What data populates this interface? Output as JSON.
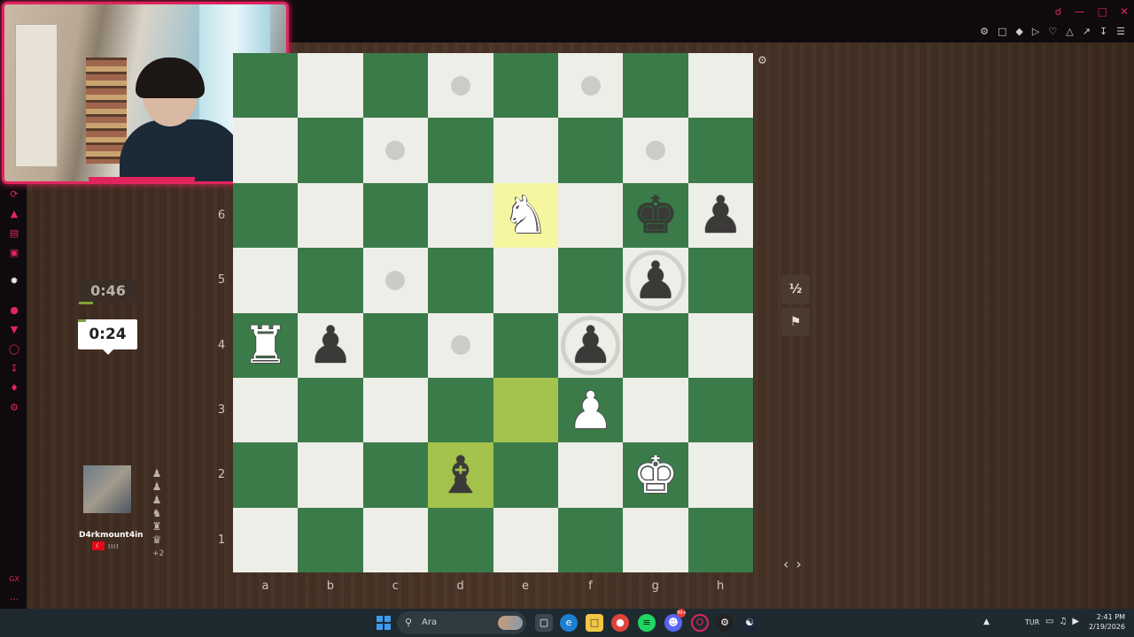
{
  "topbar": {
    "window_controls": [
      "search-icon",
      "minimize-icon",
      "maximize-icon",
      "close-icon"
    ],
    "toolbar_icons": [
      "pin-icon",
      "crop-icon",
      "shield-icon",
      "play-icon",
      "heart-icon",
      "puzzle-icon",
      "share-icon",
      "download-icon",
      "menu-icon"
    ]
  },
  "sidebar": {
    "icons": [
      "refresh-icon",
      "cart-icon",
      "gamepad-icon",
      "m-icon",
      "chatgpt-icon",
      "record-icon",
      "pin-icon",
      "clock-icon",
      "download-icon",
      "puzzle-icon",
      "settings-icon",
      "gx-icon",
      "more-icon"
    ],
    "bottom_label": "GX",
    "more_label": "..."
  },
  "game": {
    "opponent_time": "0:46",
    "my_time": "0:24",
    "player_name": "D4rkmount4in",
    "flag": "TR",
    "rating_marks": "IIII",
    "captured_pieces": [
      "♟",
      "♟",
      "♟",
      "♞",
      "♜",
      "♛"
    ],
    "captured_advantage": "+2",
    "ranks": [
      "6",
      "5",
      "4",
      "3",
      "2",
      "1"
    ],
    "files": [
      "a",
      "b",
      "c",
      "d",
      "e",
      "f",
      "g",
      "h"
    ],
    "draw_label": "½",
    "resign_label": "⚑",
    "nav_left": "‹",
    "nav_right": "›",
    "board": [
      [
        "",
        "",
        "",
        "",
        "",
        "",
        "",
        ""
      ],
      [
        "",
        "",
        "",
        "",
        "",
        "",
        "",
        ""
      ],
      [
        "",
        "",
        "",
        "",
        "N",
        "",
        "k",
        "p"
      ],
      [
        "",
        "",
        "",
        "",
        "",
        "",
        "p",
        ""
      ],
      [
        "R",
        "p",
        "",
        "",
        "",
        "p",
        "",
        ""
      ],
      [
        "",
        "",
        "",
        "",
        "",
        "P",
        "",
        ""
      ],
      [
        "",
        "",
        "",
        "b",
        "",
        "",
        "K",
        ""
      ],
      [
        "",
        "",
        "",
        "",
        "",
        "",
        "",
        ""
      ]
    ],
    "move_dots": [
      [
        0,
        3
      ],
      [
        0,
        5
      ],
      [
        1,
        2
      ],
      [
        1,
        6
      ],
      [
        3,
        2
      ],
      [
        4,
        3
      ]
    ],
    "capture_rings": [
      [
        3,
        6
      ],
      [
        4,
        5
      ]
    ],
    "highlights": [
      [
        2,
        4,
        "knight"
      ],
      [
        5,
        4,
        "last"
      ],
      [
        6,
        3,
        "last"
      ]
    ],
    "colors": {
      "light": "#eeeee8",
      "dark": "#3b7b4a",
      "highlight": "#a3c34c",
      "knight_highlight": "#f6f6a0",
      "accent": "#e0245e"
    }
  },
  "taskbar": {
    "search_placeholder": "Ara",
    "apps": [
      "task-view-icon",
      "edge-icon",
      "file-explorer-icon",
      "chrome-icon",
      "spotify-icon",
      "discord-icon",
      "opera-gx-icon",
      "steam-record-icon",
      "steam-icon"
    ],
    "discord_badge": "99+",
    "language": "TUR",
    "time": "2:41 PM",
    "date": "2/19/2026"
  }
}
